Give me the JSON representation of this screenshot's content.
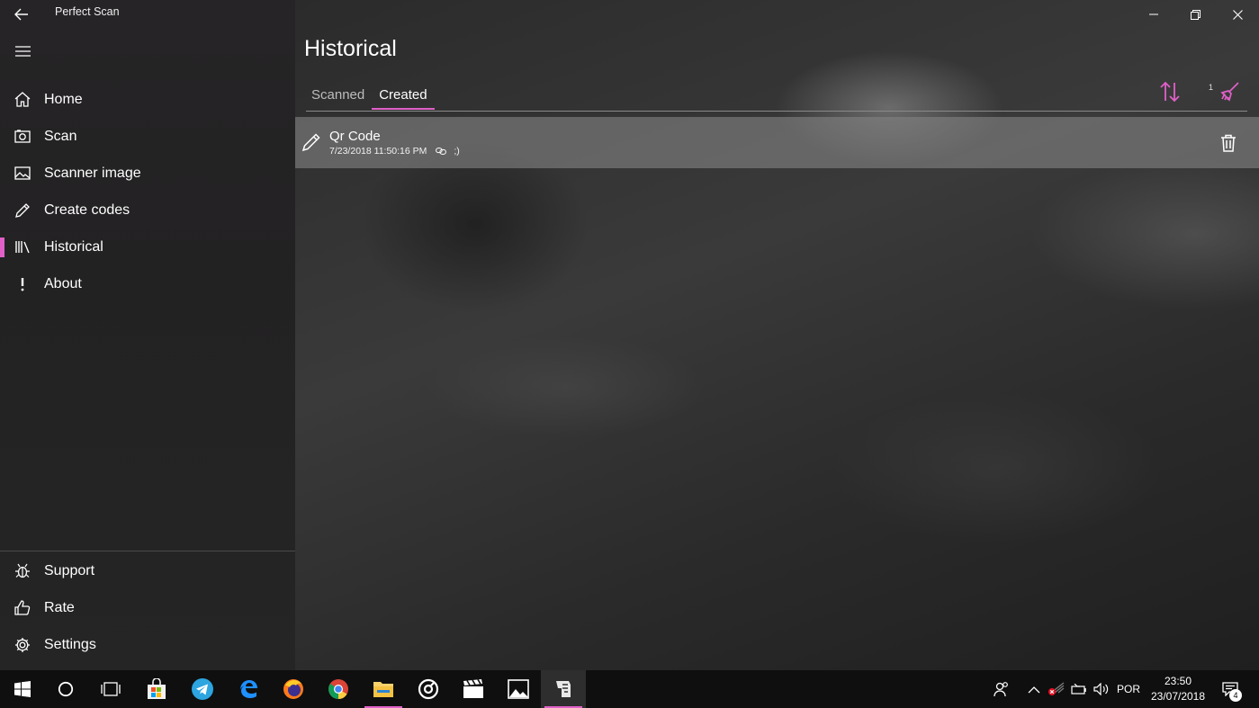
{
  "app": {
    "title": "Perfect Scan"
  },
  "sidebar": {
    "items": [
      {
        "label": "Home",
        "icon": "home-icon"
      },
      {
        "label": "Scan",
        "icon": "scan-icon"
      },
      {
        "label": "Scanner image",
        "icon": "image-icon"
      },
      {
        "label": "Create codes",
        "icon": "pencil-icon"
      },
      {
        "label": "Historical",
        "icon": "library-icon",
        "selected": true
      },
      {
        "label": "About",
        "icon": "exclamation-icon"
      }
    ],
    "bottom_items": [
      {
        "label": "Support",
        "icon": "bug-icon"
      },
      {
        "label": "Rate",
        "icon": "thumbs-up-icon"
      },
      {
        "label": "Settings",
        "icon": "gear-icon"
      }
    ]
  },
  "page": {
    "title": "Historical",
    "tabs": [
      {
        "label": "Scanned",
        "active": false
      },
      {
        "label": "Created",
        "active": true
      }
    ],
    "clear_count": "1"
  },
  "list": {
    "items": [
      {
        "title": "Qr Code",
        "date": "7/23/2018 11:50:16 PM",
        "content": ";)"
      }
    ]
  },
  "taskbar": {
    "language": "POR",
    "time": "23:50",
    "date": "23/07/2018",
    "notifications": "4"
  },
  "colors": {
    "accent": "#e060c8",
    "sidebar_bg": "#252525",
    "taskbar_bg": "#0f0f0f",
    "list_item_bg": "#828282"
  }
}
